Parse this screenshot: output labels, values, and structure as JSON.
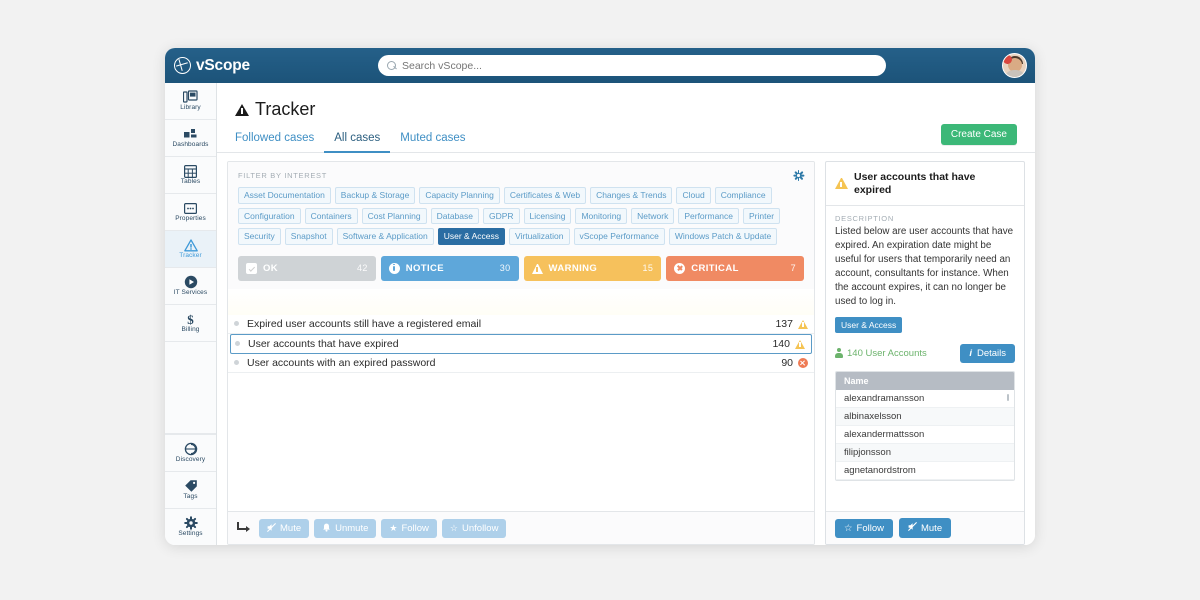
{
  "app": {
    "brand": "vScope",
    "search_placeholder": "Search vScope..."
  },
  "sidebar": {
    "items": [
      {
        "label": "Library",
        "icon": "library-icon",
        "active": false
      },
      {
        "label": "Dashboards",
        "icon": "dashboards-icon",
        "active": false
      },
      {
        "label": "Tables",
        "icon": "tables-icon",
        "active": false
      },
      {
        "label": "Properties",
        "icon": "properties-icon",
        "active": false
      },
      {
        "label": "Tracker",
        "icon": "tracker-warning-icon",
        "active": true
      },
      {
        "label": "IT Services",
        "icon": "it-services-icon",
        "active": false
      },
      {
        "label": "Billing",
        "icon": "billing-dollar-icon",
        "active": false
      }
    ],
    "bottom_items": [
      {
        "label": "Discovery",
        "icon": "discovery-icon"
      },
      {
        "label": "Tags",
        "icon": "tags-icon"
      },
      {
        "label": "Settings",
        "icon": "gear-icon"
      }
    ]
  },
  "page": {
    "title": "Tracker",
    "tabs": [
      {
        "label": "Followed cases",
        "active": false
      },
      {
        "label": "All cases",
        "active": true
      },
      {
        "label": "Muted cases",
        "active": false
      }
    ],
    "create_case_label": "Create Case"
  },
  "filter": {
    "heading": "FILTER BY INTEREST",
    "tags": [
      {
        "label": "Asset Documentation",
        "selected": false
      },
      {
        "label": "Backup & Storage",
        "selected": false
      },
      {
        "label": "Capacity Planning",
        "selected": false
      },
      {
        "label": "Certificates & Web",
        "selected": false
      },
      {
        "label": "Changes & Trends",
        "selected": false
      },
      {
        "label": "Cloud",
        "selected": false
      },
      {
        "label": "Compliance",
        "selected": false
      },
      {
        "label": "Configuration",
        "selected": false
      },
      {
        "label": "Containers",
        "selected": false
      },
      {
        "label": "Cost Planning",
        "selected": false
      },
      {
        "label": "Database",
        "selected": false
      },
      {
        "label": "GDPR",
        "selected": false
      },
      {
        "label": "Licensing",
        "selected": false
      },
      {
        "label": "Monitoring",
        "selected": false
      },
      {
        "label": "Network",
        "selected": false
      },
      {
        "label": "Performance",
        "selected": false
      },
      {
        "label": "Printer",
        "selected": false
      },
      {
        "label": "Security",
        "selected": false
      },
      {
        "label": "Snapshot",
        "selected": false
      },
      {
        "label": "Software & Application",
        "selected": false
      },
      {
        "label": "User & Access",
        "selected": true
      },
      {
        "label": "Virtualization",
        "selected": false
      },
      {
        "label": "vScope Performance",
        "selected": false
      },
      {
        "label": "Windows Patch & Update",
        "selected": false
      }
    ]
  },
  "status_bar": [
    {
      "label": "OK",
      "count": "42",
      "color": "#cfd3d6",
      "icon": "check-icon"
    },
    {
      "label": "NOTICE",
      "count": "30",
      "color": "#5ea7da",
      "icon": "info-icon"
    },
    {
      "label": "WARNING",
      "count": "15",
      "color": "#f6c15c",
      "icon": "warning-icon"
    },
    {
      "label": "CRITICAL",
      "count": "7",
      "color": "#f08a63",
      "icon": "critical-icon"
    }
  ],
  "cases": [
    {
      "title": "Expired user accounts still have a registered email",
      "count": "137",
      "severity": "warning",
      "selected": false
    },
    {
      "title": "User accounts that have expired",
      "count": "140",
      "severity": "warning",
      "selected": true
    },
    {
      "title": "User accounts with an expired password",
      "count": "90",
      "severity": "critical",
      "selected": false
    }
  ],
  "case_toolbar": {
    "buttons": [
      {
        "label": "Mute",
        "icon": "mute-icon"
      },
      {
        "label": "Unmute",
        "icon": "bell-icon"
      },
      {
        "label": "Follow",
        "icon": "star-filled-icon"
      },
      {
        "label": "Unfollow",
        "icon": "star-outline-icon"
      }
    ]
  },
  "detail_panel": {
    "title": "User accounts that have expired",
    "description_label": "DESCRIPTION",
    "description": "Listed below are user accounts that have expired. An expiration date might be useful for users that temporarily need an account, consultants for instance. When the account expires, it can no longer be used to log in.",
    "tag": "User & Access",
    "count_label": "140 User Accounts",
    "details_label": "Details",
    "table": {
      "column": "Name",
      "rows": [
        "alexandramansson",
        "albinaxelsson",
        "alexandermattsson",
        "filipjonsson",
        "agnetanordstrom"
      ]
    },
    "footer_buttons": [
      {
        "label": "Follow",
        "icon": "star-outline-icon"
      },
      {
        "label": "Mute",
        "icon": "mute-icon"
      }
    ]
  },
  "colors": {
    "topbar": "#1e5b85",
    "accent_blue": "#3f8fc4",
    "green": "#3cb878",
    "warning": "#f5c453",
    "critical": "#ef7b54"
  }
}
